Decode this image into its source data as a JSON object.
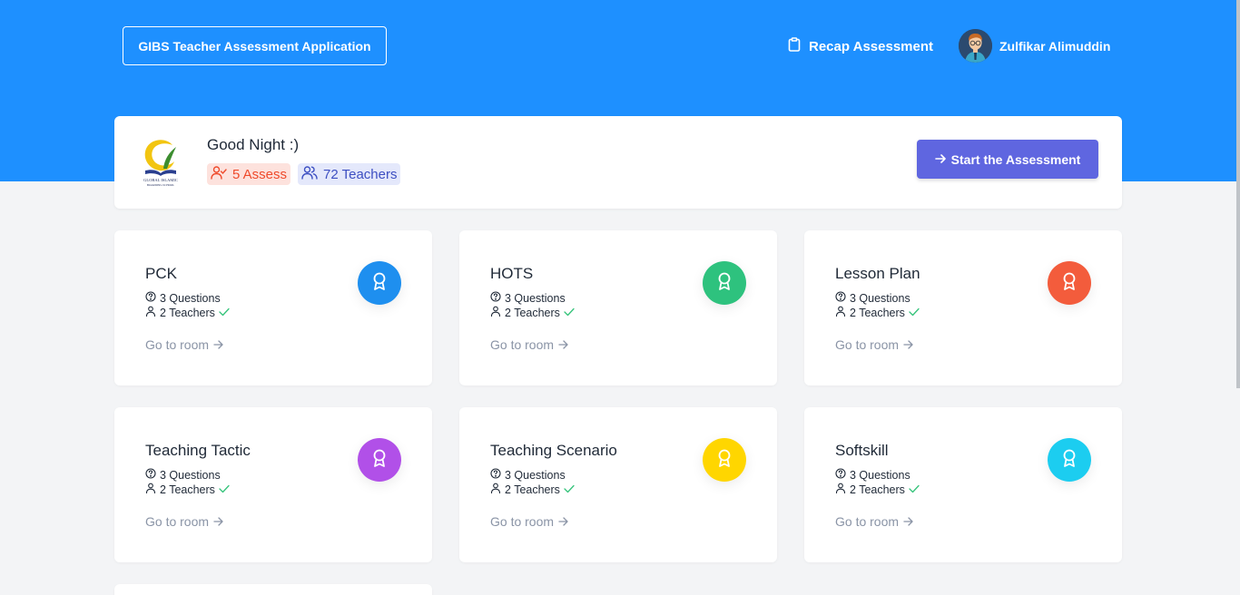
{
  "header": {
    "app_title": "GIBS Teacher Assessment Application",
    "recap_label": "Recap Assessment",
    "user_name": "Zulfikar Alimuddin",
    "brand_color": "#1e90ff"
  },
  "banner": {
    "greeting": "Good Night :)",
    "assess_badge": "5 Assess",
    "teachers_badge": "72 Teachers",
    "start_button": "Start the Assessment",
    "logo_text_line1": "GLOBAL ISLAMIC",
    "logo_text_line2": "BOARDING SCHOOL"
  },
  "cards": [
    {
      "title": "PCK",
      "questions": "3 Questions",
      "teachers": "2 Teachers",
      "link": "Go to room",
      "color": "#1e8fef"
    },
    {
      "title": "HOTS",
      "questions": "3 Questions",
      "teachers": "2 Teachers",
      "link": "Go to room",
      "color": "#2ec27e"
    },
    {
      "title": "Lesson Plan",
      "questions": "3 Questions",
      "teachers": "2 Teachers",
      "link": "Go to room",
      "color": "#f35c3c"
    },
    {
      "title": "Teaching Tactic",
      "questions": "3 Questions",
      "teachers": "2 Teachers",
      "link": "Go to room",
      "color": "#b150e8"
    },
    {
      "title": "Teaching Scenario",
      "questions": "3 Questions",
      "teachers": "2 Teachers",
      "link": "Go to room",
      "color": "#ffd600"
    },
    {
      "title": "Softskill",
      "questions": "3 Questions",
      "teachers": "2 Teachers",
      "link": "Go to room",
      "color": "#1ccdf0"
    }
  ]
}
